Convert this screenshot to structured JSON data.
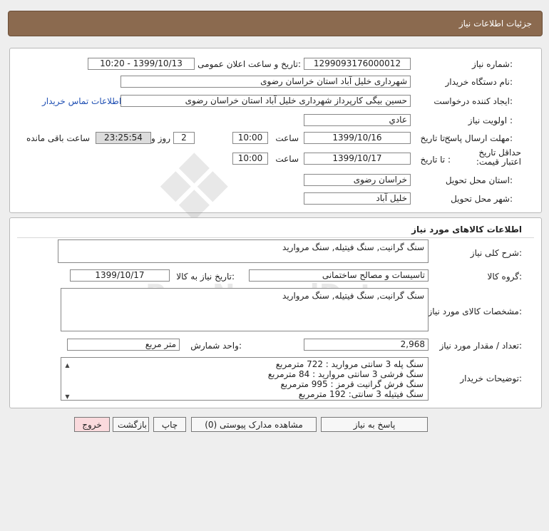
{
  "header": {
    "title": "جزئیات اطلاعات نیاز"
  },
  "info": {
    "need_number_label": "شماره نیاز:",
    "need_number": "1299093176000012",
    "announce_label": "تاریخ و ساعت اعلان عمومی:",
    "announce_value": "1399/10/13 - 10:20",
    "buyer_label": "نام دستگاه خریدار:",
    "buyer_value": "شهرداری خلیل آباد استان خراسان رضوی",
    "creator_label": "ایجاد کننده درخواست:",
    "creator_value": "حسین بیگی کارپرداز شهرداری خلیل آباد استان خراسان رضوی",
    "contact_link": "اطلاعات تماس خریدار",
    "priority_label": "اولویت نیاز :",
    "priority_value": "عادي",
    "deadline_label": "مهلت ارسال پاسخ:",
    "to_date_label": "تا تاریخ :",
    "deadline_date": "1399/10/16",
    "time_label": "ساعت",
    "deadline_time": "10:00",
    "days_value": "2",
    "days_label": "روز و",
    "remaining_time": "23:25:54",
    "remaining_label": "ساعت باقی مانده",
    "validity_label": "حداقل تاریخ اعتبار قیمت:",
    "validity_date": "1399/10/17",
    "validity_time": "10:00",
    "province_label": "استان محل تحویل:",
    "province_value": "خراسان رضوی",
    "city_label": "شهر محل تحویل:",
    "city_value": "خلیل آباد"
  },
  "goods": {
    "section_title": "اطلاعات کالاهای مورد نیاز",
    "summary_label": "شرح کلی نیاز:",
    "summary_value": "سنگ گرانیت, سنگ فیتیله, سنگ مروارید",
    "group_label": "گروه کالا:",
    "group_value": "تاسیسات و مصالح ساختمانی",
    "need_date_label": "تاریخ نیاز به کالا:",
    "need_date_value": "1399/10/17",
    "spec_label": "مشخصات کالای مورد نیاز:",
    "spec_value": "سنگ گرانیت, سنگ فیتیله, سنگ مروارید",
    "qty_label": "تعداد / مقدار مورد نیاز:",
    "qty_value": "2,968",
    "unit_label": "واحد شمارش:",
    "unit_value": "متر مربع",
    "desc_label": "توضیحات خریدار:",
    "desc_lines": [
      "سنگ پله 3 سانتی مروارید : 722 مترمربع",
      "سنگ فرشی 3 سانتی مروارید : 84 مترمربع",
      "سنگ فرش گرانیت قرمز : 995 مترمربع",
      "سنگ فیتیله 3 سانتی: 192 مترمربع"
    ]
  },
  "buttons": {
    "reply": "پاسخ به نیاز",
    "attachments": "مشاهده مدارک پیوستی (0)",
    "print": "چاپ",
    "back": "بازگشت",
    "exit": "خروج"
  },
  "icons": {
    "scroll_up": "chevron-up-icon",
    "scroll_down": "chevron-down-icon"
  }
}
